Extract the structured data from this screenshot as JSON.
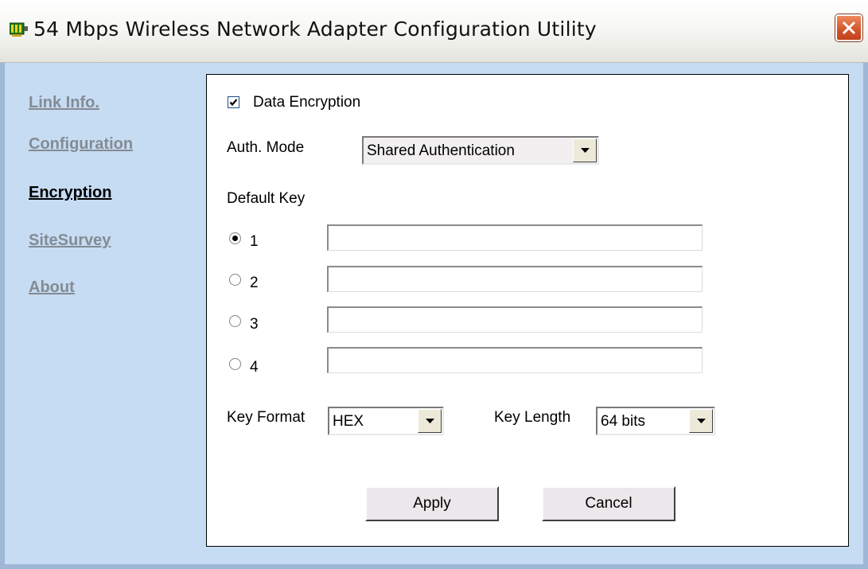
{
  "window": {
    "title": "54 Mbps Wireless Network Adapter Configuration Utility",
    "close_icon": "close-x-icon"
  },
  "nav": {
    "items": [
      {
        "label": "Link Info.",
        "active": false
      },
      {
        "label": "Configuration",
        "active": false
      },
      {
        "label": "Encryption",
        "active": true
      },
      {
        "label": "SiteSurvey",
        "active": false
      },
      {
        "label": "About",
        "active": false
      }
    ]
  },
  "encryption": {
    "data_encryption_label": "Data Encryption",
    "data_encryption_checked": true,
    "auth_mode_label": "Auth. Mode",
    "auth_mode_value": "Shared Authentication",
    "default_key_label": "Default Key",
    "keys": [
      {
        "label": "1",
        "selected": true,
        "value": ""
      },
      {
        "label": "2",
        "selected": false,
        "value": ""
      },
      {
        "label": "3",
        "selected": false,
        "value": ""
      },
      {
        "label": "4",
        "selected": false,
        "value": ""
      }
    ],
    "key_format_label": "Key Format",
    "key_format_value": "HEX",
    "key_length_label": "Key Length",
    "key_length_value": "64 bits",
    "apply_label": "Apply",
    "cancel_label": "Cancel"
  },
  "colors": {
    "client_background": "#c6dcf3",
    "nav_inactive": "#848b93",
    "nav_active": "#000000",
    "close_button": "#d2532a"
  }
}
